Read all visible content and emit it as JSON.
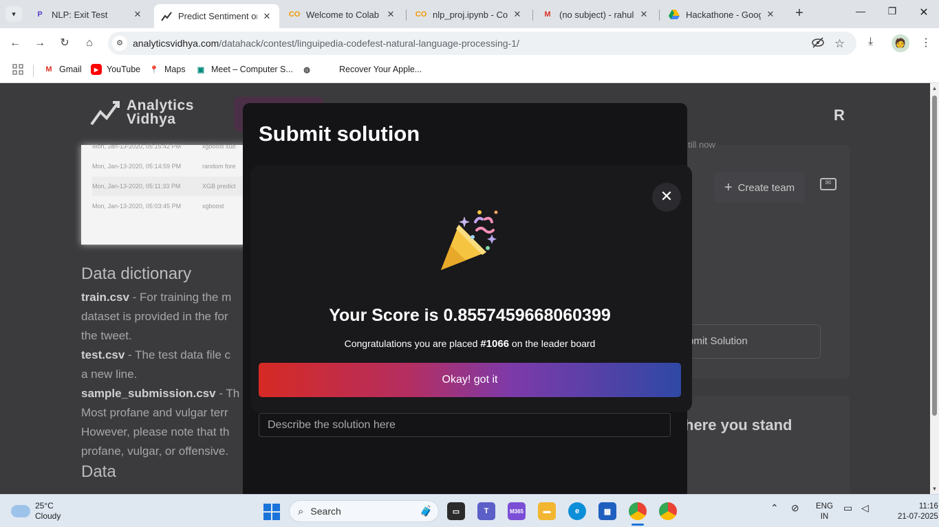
{
  "browser": {
    "tabs": [
      {
        "title": "NLP: Exit Test",
        "icon": "P"
      },
      {
        "title": "Predict Sentiment on",
        "icon": "av"
      },
      {
        "title": "Welcome to Colab - C",
        "icon": "CO"
      },
      {
        "title": "nlp_proj.ipynb - Cola",
        "icon": "CO"
      },
      {
        "title": "(no subject) - rahuldh",
        "icon": "M"
      },
      {
        "title": "Hackathone - Google",
        "icon": "drive"
      }
    ],
    "url_host": "analyticsvidhya.com",
    "url_path": "/datahack/contest/linguipedia-codefest-natural-language-processing-1/",
    "bookmarks": [
      "Gmail",
      "YouTube",
      "Maps",
      "Meet – Computer S...",
      "",
      "Recover Your Apple..."
    ]
  },
  "page": {
    "logo_line1": "Analytics",
    "logo_line2": "Vidhya",
    "avatar_initial": "R",
    "submission_rows": [
      {
        "date": "Mon, Jan-13-2020, 05:15:42 PM",
        "desc": "xgboost sub"
      },
      {
        "date": "Mon, Jan-13-2020, 05:14:59 PM",
        "desc": "random fore"
      },
      {
        "date": "Mon, Jan-13-2020, 05:11:33 PM",
        "desc": "XGB predict"
      },
      {
        "date": "Mon, Jan-13-2020, 05:03:45 PM",
        "desc": "xgboost"
      }
    ],
    "dict_title": "Data dictionary",
    "train_label": "train.csv",
    "train_text": " - For training the m",
    "line2": "dataset is provided in the for",
    "line3": "the tweet.",
    "test_label": "test.csv",
    "test_text": " - The test data file c",
    "line5": "a new line.",
    "sample_label": "sample_submission.csv",
    "sample_text": " - Th",
    "line7": "Most profane and vulgar terr",
    "line8": "However, please note that th",
    "line9": "profane, vulgar, or offensive.",
    "data_title": "Data",
    "right_sub": "y till now",
    "create_team": "Create team",
    "submit_solution_bg": "bmit Solution",
    "where_stand": "here you stand"
  },
  "modal_back": {
    "title": "Submit solution",
    "desc_placeholder": "Describe the solution here"
  },
  "modal": {
    "score_text": "Your Score is 0.8557459668060399",
    "congrats_prefix": "Congratulations you are placed ",
    "rank": "#1066",
    "congrats_suffix": " on the leader board",
    "button_label": "Okay! got it"
  },
  "taskbar": {
    "temp": "25°C",
    "condition": "Cloudy",
    "search_label": "Search",
    "lang1": "ENG",
    "lang2": "IN",
    "time": "11:16",
    "date": "21-07-2025"
  },
  "colors": {
    "modal_bg": "#19181b",
    "button_gradient_start": "#d62a24",
    "button_gradient_end": "#2f48a5"
  }
}
